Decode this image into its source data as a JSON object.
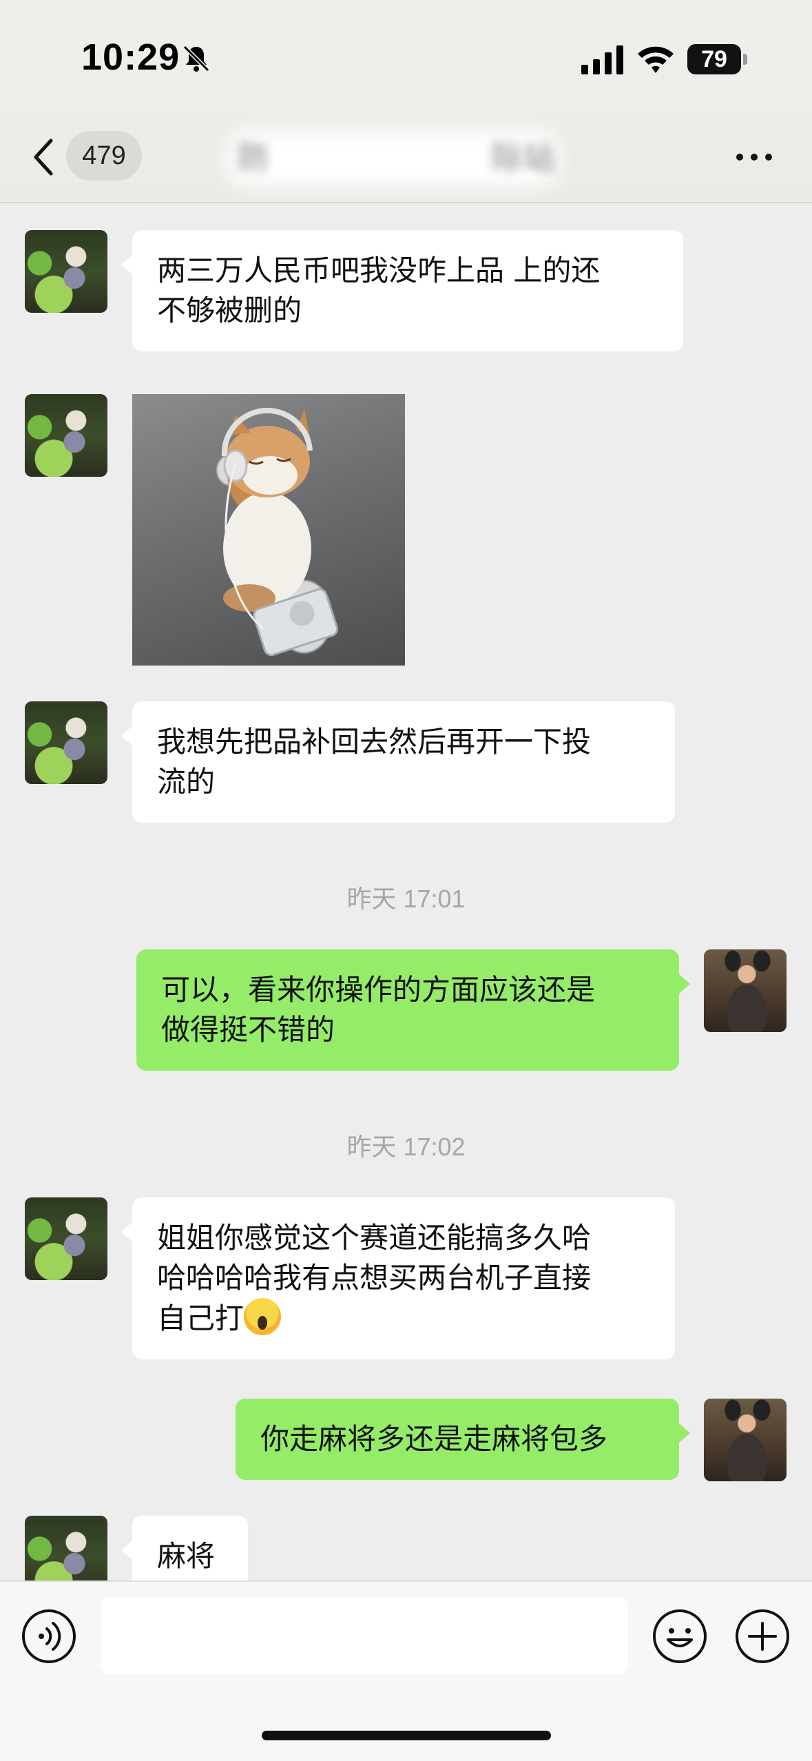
{
  "status_bar": {
    "time": "10:29",
    "battery": "79",
    "icons": [
      "bell-muted-icon",
      "signal-icon",
      "wifi-icon",
      "battery-icon"
    ]
  },
  "header": {
    "unread_count": "479",
    "title": "防                      际站",
    "icons": [
      "chevron-left-icon",
      "more-icon"
    ]
  },
  "messages": [
    {
      "from": "other",
      "text": "两三万人民币吧我没咋上品 上的还\n不够被删的"
    },
    {
      "from": "other",
      "type": "image"
    },
    {
      "from": "other",
      "text": "我想先把品补回去然后再开一下投\n流的"
    },
    {
      "type": "time",
      "text": "昨天 17:01"
    },
    {
      "from": "me",
      "text": "可以，看来你操作的方面应该还是\n做得挺不错的"
    },
    {
      "type": "time",
      "text": "昨天 17:02"
    },
    {
      "from": "other",
      "text": "姐姐你感觉这个赛道还能搞多久哈\n哈哈哈哈我有点想买两台机子直接\n自己打",
      "emoji": "scream-emoji"
    },
    {
      "from": "me",
      "text": "你走麻将多还是走麻将包多"
    },
    {
      "from": "other",
      "text": "麻将"
    }
  ],
  "input_bar": {
    "placeholder": "",
    "icons": [
      "voice-icon",
      "emoji-icon",
      "plus-icon"
    ]
  },
  "colors": {
    "background": "#ededed",
    "incoming_bubble": "#ffffff",
    "outgoing_bubble": "#95ec69",
    "timestamp": "#a6a6a6"
  }
}
